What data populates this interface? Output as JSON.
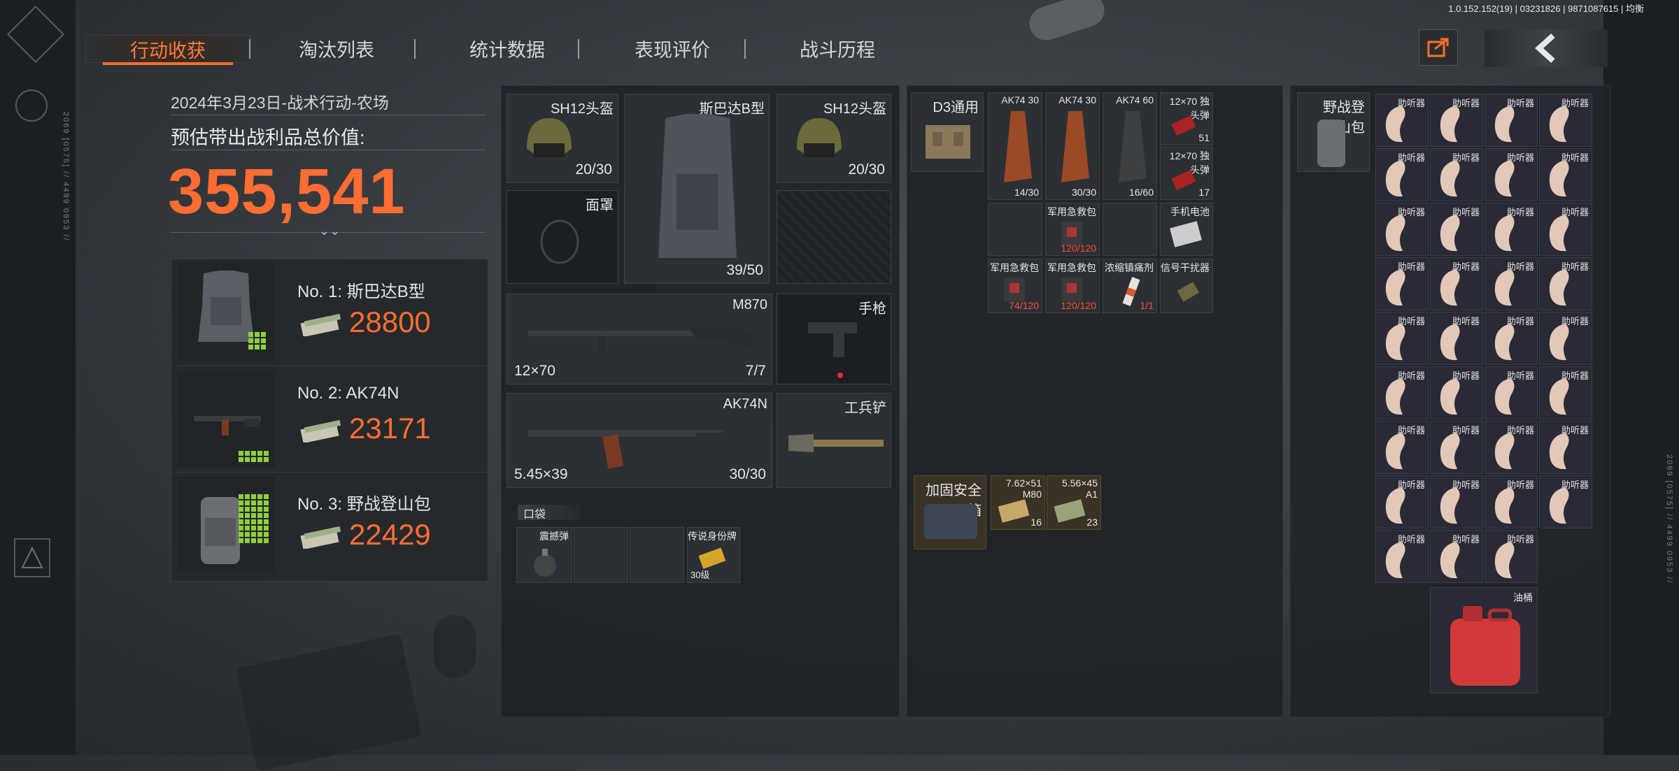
{
  "version_info": "1.0.152.152(19) | 03231826 | 9871087615 | 均衡",
  "tabs": [
    {
      "label": "行动收获",
      "active": true
    },
    {
      "label": "淘汰列表",
      "active": false
    },
    {
      "label": "统计数据",
      "active": false
    },
    {
      "label": "表现评价",
      "active": false
    },
    {
      "label": "战斗历程",
      "active": false
    }
  ],
  "summary": {
    "date_line": "2024年3月23日-战术行动-农场",
    "estimate_label": "预估带出战利品总价值:",
    "total_value": "355,541"
  },
  "top_items": [
    {
      "rank": "No. 1: 斯巴达B型",
      "value": "28800",
      "icon": "body-armor-icon"
    },
    {
      "rank": "No. 2: AK74N",
      "value": "23171",
      "icon": "rifle-icon"
    },
    {
      "rank": "No. 3: 野战登山包",
      "value": "22429",
      "icon": "backpack-icon"
    }
  ],
  "equipment": {
    "helmet": {
      "name": "SH12头盔",
      "durability": "20/30"
    },
    "armor": {
      "name": "斯巴达B型",
      "durability": "39/50"
    },
    "helmet2": {
      "name": "SH12头盔",
      "durability": "20/30"
    },
    "mask": {
      "name": "面罩"
    },
    "primary": {
      "name": "M870",
      "ammo_type": "12×70",
      "ammo": "7/7"
    },
    "pistol": {
      "name": "手枪"
    },
    "secondary": {
      "name": "AK74N",
      "ammo_type": "5.45×39",
      "ammo": "30/30"
    },
    "melee": {
      "name": "工兵铲"
    },
    "pocket_header": "口袋",
    "pockets": [
      {
        "name": "震撼弹"
      },
      {
        "name": ""
      },
      {
        "name": ""
      },
      {
        "name": "传说身份牌",
        "count": "30级"
      }
    ]
  },
  "rig": {
    "name": "D3通用",
    "mags": [
      {
        "name": "AK74 30",
        "count": "14/30"
      },
      {
        "name": "AK74 30",
        "count": "30/30"
      },
      {
        "name": "AK74 60",
        "count": "16/60"
      }
    ],
    "slugs": [
      {
        "name": "12×70 独头弹",
        "count": "51"
      },
      {
        "name": "12×70 独头弹",
        "count": "17"
      }
    ],
    "row2": [
      {
        "name": "军用急救包",
        "count": "120/120",
        "red": true
      },
      {
        "name": "手机电池",
        "count": ""
      }
    ],
    "row3": [
      {
        "name": "军用急救包",
        "count": "74/120",
        "red": true
      },
      {
        "name": "军用急救包",
        "count": "120/120",
        "red": true
      },
      {
        "name": "浓缩镇痛剂",
        "count": "1/1",
        "red": true
      },
      {
        "name": "信号干扰器",
        "count": ""
      }
    ]
  },
  "safe_box": {
    "name": "加固安全箱",
    "items": [
      {
        "name": "7.62×51 M80",
        "count": "16"
      },
      {
        "name": "5.56×45 A1",
        "count": "23"
      }
    ]
  },
  "backpack": {
    "name": "野战登山包",
    "item_label": "助听器",
    "item_count": 35,
    "fuel": "油桶"
  }
}
